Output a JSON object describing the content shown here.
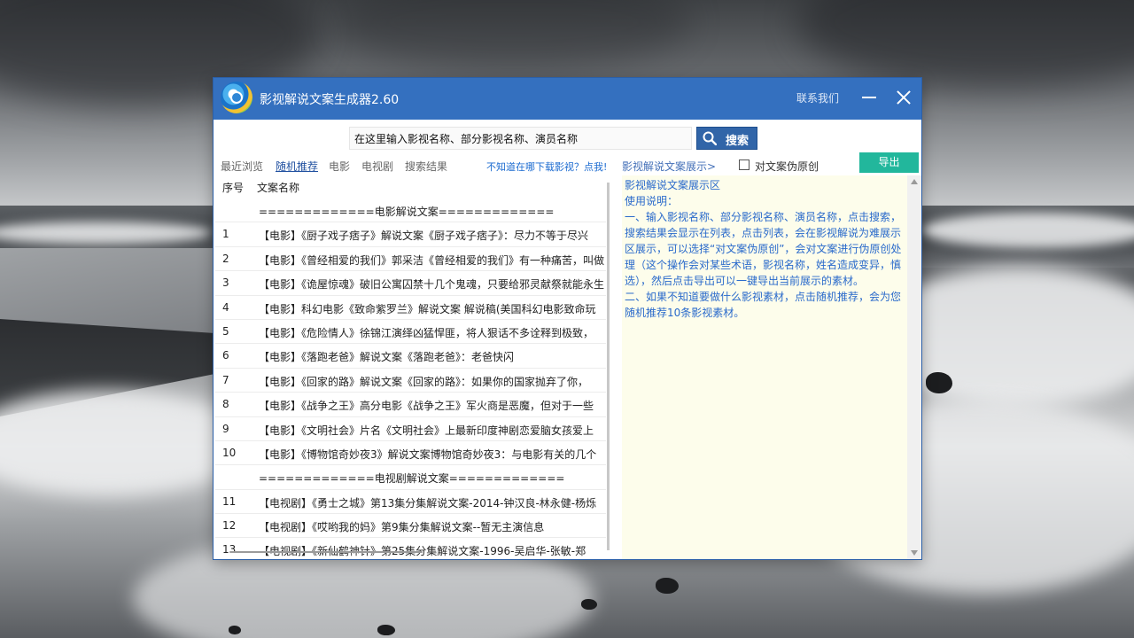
{
  "window": {
    "title": "影视解说文案生成器2.60",
    "contact_label": "联系我们"
  },
  "search": {
    "value": "在这里输入影视名称、部分影视名称、演员名称",
    "button_label": "搜索"
  },
  "tabs": [
    {
      "label": "最近浏览"
    },
    {
      "label": "随机推荐"
    },
    {
      "label": "电影"
    },
    {
      "label": "电视剧"
    },
    {
      "label": "搜索结果"
    }
  ],
  "toolbar": {
    "download_hint": "不知道在哪下载影视？点我!",
    "show_link": "影视解说文案展示>",
    "pseudo_label": "对文案伪原创",
    "export_label": "导出"
  },
  "list": {
    "columns": [
      "序号",
      "文案名称"
    ],
    "rows": [
      {
        "num": "",
        "name": "=============电影解说文案============="
      },
      {
        "num": "1",
        "name": "【电影】《厨子戏子痞子》解说文案《厨子戏子痞子》：尽力不等于尽兴"
      },
      {
        "num": "2",
        "name": "【电影】《曾经相爱的我们》郭采洁《曾经相爱的我们》有一种痛苦，叫做"
      },
      {
        "num": "3",
        "name": "【电影】《诡屋惊魂》破旧公寓囚禁十几个鬼魂，只要给邪灵献祭就能永生"
      },
      {
        "num": "4",
        "name": "【电影】科幻电影《致命紫罗兰》解说文案 解说稿(美国科幻电影致命玩"
      },
      {
        "num": "5",
        "name": "【电影】《危险情人》徐锦江演绎凶猛悍匪，将人狠话不多诠释到极致，"
      },
      {
        "num": "6",
        "name": "【电影】《落跑老爸》解说文案《落跑老爸》：老爸快闪"
      },
      {
        "num": "7",
        "name": "【电影】《回家的路》解说文案《回家的路》：如果你的国家抛弃了你，"
      },
      {
        "num": "8",
        "name": "【电影】《战争之王》高分电影《战争之王》军火商是恶魔，但对于一些"
      },
      {
        "num": "9",
        "name": "【电影】《文明社会》片名《文明社会》上最新印度神剧恋爱脑女孩爱上"
      },
      {
        "num": "10",
        "name": "【电影】《博物馆奇妙夜3》解说文案博物馆奇妙夜3：与电影有关的几个"
      },
      {
        "num": "",
        "name": "=============电视剧解说文案============="
      },
      {
        "num": "11",
        "name": "【电视剧】《勇士之城》第13集分集解说文案-2014-钟汉良-林永健-杨烁"
      },
      {
        "num": "12",
        "name": "【电视剧】《哎哟我的妈》第9集分集解说文案--暂无主演信息"
      },
      {
        "num": "13",
        "name": "【电视剧】《新仙鹤神针》第25集分集解说文案-1996-吴启华-张敏-郑"
      }
    ]
  },
  "preview": {
    "lines": [
      "影视解说文案展示区",
      "使用说明：",
      "一、输入影视名称、部分影视名称、演员名称，点击搜索，搜索结果会显示在列表，点击列表，会在影视解说为难展示区展示，可以选择“对文案伪原创”，会对文案进行伪原创处理（这个操作会对某些术语，影视名称，姓名造成变异，慎选），然后点击导出可以一键导出当前展示的素材。",
      "二、如果不知道要做什么影视素材，点击随机推荐，会为您随机推荐10条影视素材。"
    ]
  }
}
